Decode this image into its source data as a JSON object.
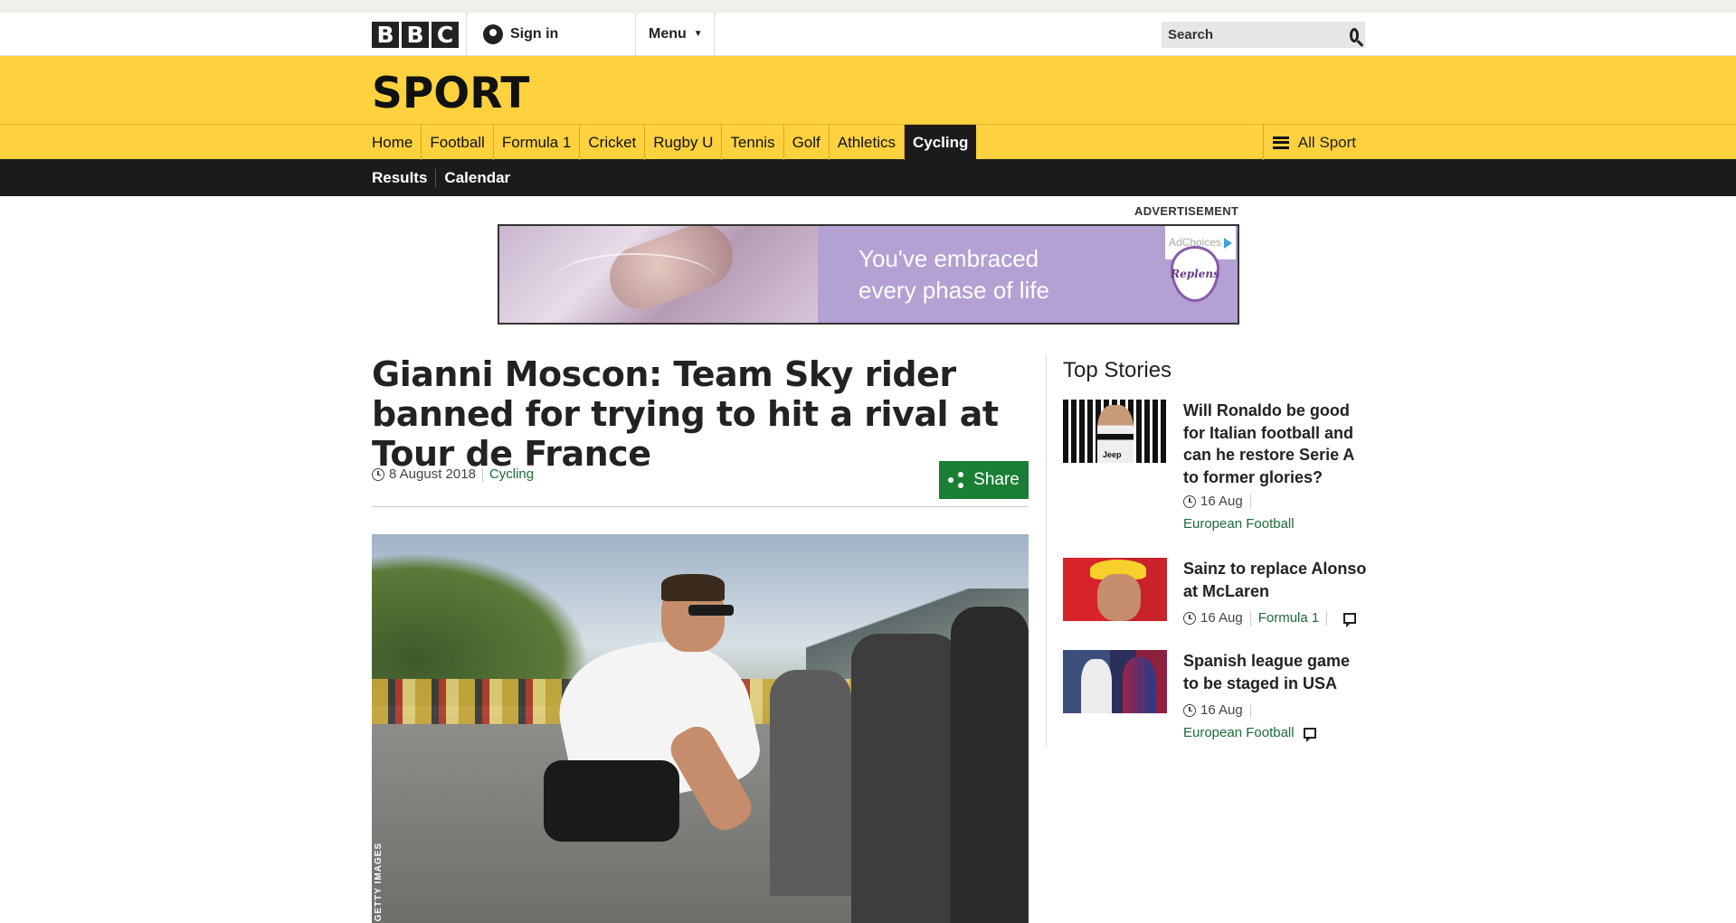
{
  "header": {
    "logo": [
      "B",
      "B",
      "C"
    ],
    "signin_label": "Sign in",
    "menu_label": "Menu",
    "search_placeholder": "Search"
  },
  "section": {
    "title": "SPORT"
  },
  "nav": {
    "items": [
      {
        "label": "Home"
      },
      {
        "label": "Football"
      },
      {
        "label": "Formula 1"
      },
      {
        "label": "Cricket"
      },
      {
        "label": "Rugby U"
      },
      {
        "label": "Tennis"
      },
      {
        "label": "Golf"
      },
      {
        "label": "Athletics"
      },
      {
        "label": "Cycling",
        "active": true
      }
    ],
    "all_sport_label": "All Sport"
  },
  "subnav": {
    "items": [
      {
        "label": "Results"
      },
      {
        "label": "Calendar"
      }
    ]
  },
  "advert": {
    "label": "ADVERTISEMENT",
    "adchoices": "AdChoices",
    "line1": "You've embraced",
    "line2": "every phase of life",
    "brand": "Replens"
  },
  "article": {
    "headline": "Gianni Moscon: Team Sky rider banned for trying to hit a rival at Tour de France",
    "date": "8 August 2018",
    "topic": "Cycling",
    "share_label": "Share",
    "image_credit": "GETTY IMAGES"
  },
  "sidebar": {
    "heading": "Top Stories",
    "stories": [
      {
        "title": "Will Ronaldo be good for Italian football and can he restore Serie A to former glories?",
        "date": "16 Aug",
        "topic": "European Football",
        "has_comments": false,
        "thumb_text": "Jeep"
      },
      {
        "title": "Sainz to replace Alonso at McLaren",
        "date": "16 Aug",
        "topic": "Formula 1",
        "has_comments": true
      },
      {
        "title": "Spanish league game to be staged in USA",
        "date": "16 Aug",
        "topic": "European Football",
        "has_comments": true
      }
    ]
  },
  "colors": {
    "sport_yellow": "#fed23f",
    "nav_black": "#1b1b1b",
    "topic_green": "#1a6c35",
    "share_green": "#1a7f35"
  }
}
